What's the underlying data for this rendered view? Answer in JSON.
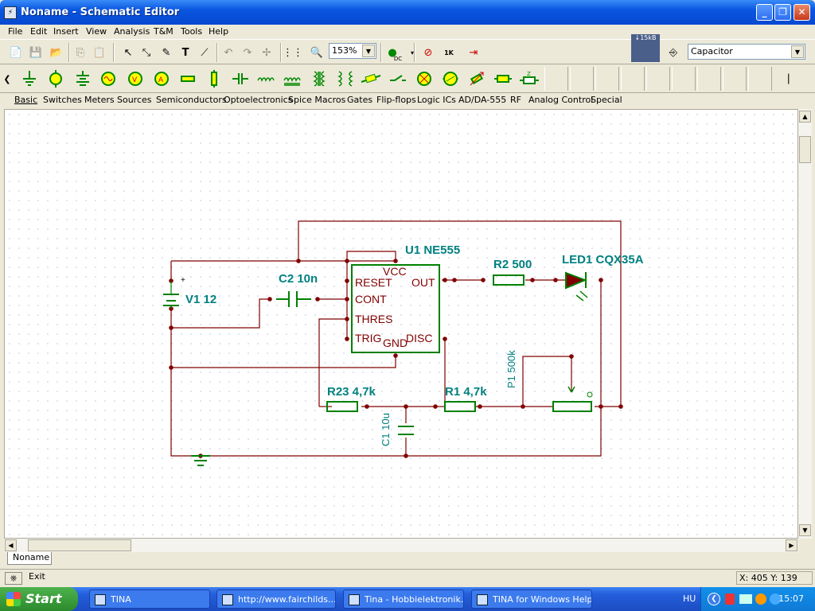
{
  "window": {
    "title": "Noname - Schematic Editor"
  },
  "menu": [
    "File",
    "Edit",
    "Insert",
    "View",
    "Analysis",
    "T&M",
    "Tools",
    "Help"
  ],
  "toolbar": {
    "zoom": "153%",
    "dc_label": "DC",
    "net_label": "↓15kB",
    "component": "Capacitor",
    "tr_label": "1K"
  },
  "component_tabs": [
    "Basic",
    "Switches",
    "Meters",
    "Sources",
    "Semiconductors",
    "Optoelectronics",
    "Spice Macros",
    "Gates",
    "Flip-flops",
    "Logic ICs",
    "AD/DA-555",
    "RF",
    "Analog Control",
    "Special"
  ],
  "schematic": {
    "labels": {
      "u1": "U1 NE555",
      "r2": "R2 500",
      "led1": "LED1 CQX35A",
      "c2": "C2 10n",
      "v1": "V1 12",
      "r23": "R23 4,7k",
      "r1": "R1 4,7k",
      "p1": "P1 500k",
      "c1": "C1 10u"
    },
    "pins": {
      "vcc": "VCC",
      "reset": "RESET",
      "out": "OUT",
      "cont": "CONT",
      "thres": "THRES",
      "trig": "TRIG",
      "gnd": "GND",
      "disc": "DISC"
    }
  },
  "document_tab": "Noname",
  "status": {
    "exit": "Exit",
    "coords": "X: 405  Y: 139"
  },
  "taskbar": {
    "start": "Start",
    "tasks": [
      "TINA",
      "http://www.fairchilds...",
      "Tina - Hobbielektronik...",
      "TINA for Windows Help"
    ],
    "lang": "HU",
    "clock": "15:07"
  },
  "colors": {
    "wire": "#800000",
    "component": "#008000",
    "label": "#008080",
    "titlebar": "#0a56e0"
  }
}
